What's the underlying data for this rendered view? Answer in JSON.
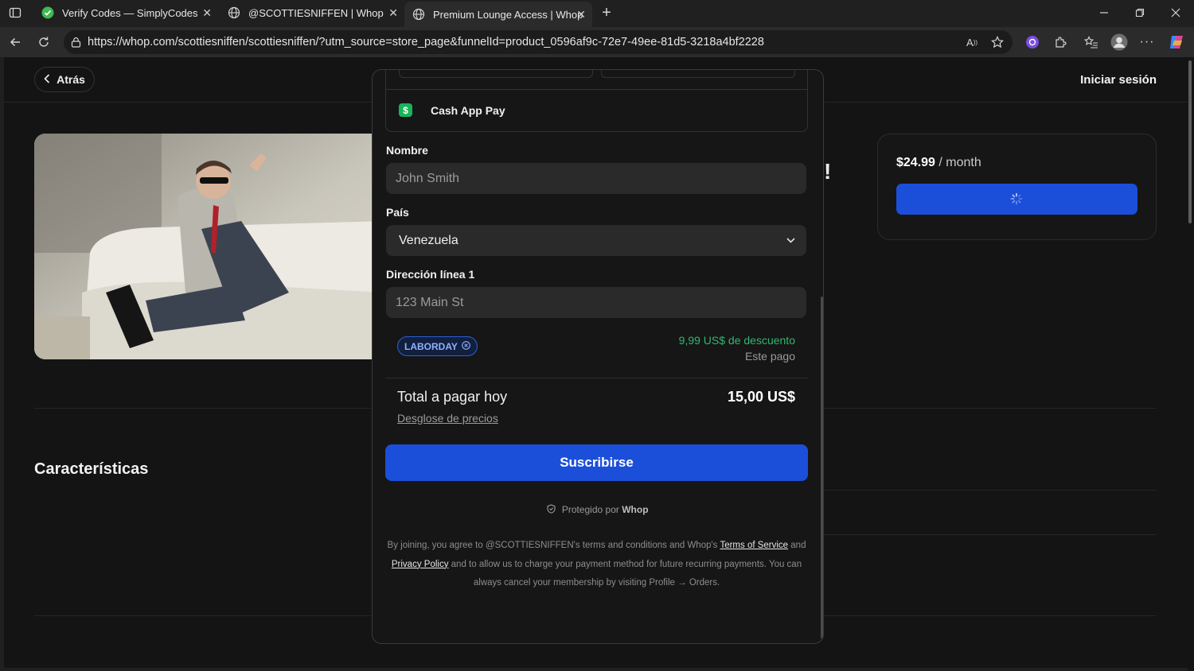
{
  "browser": {
    "tabs": [
      {
        "title": "Verify Codes — SimplyCodes",
        "icon": "simplycodes-check-icon",
        "active": false
      },
      {
        "title": "@SCOTTIESNIFFEN | Whop",
        "icon": "globe-icon",
        "active": false
      },
      {
        "title": "Premium Lounge Access | Whop",
        "icon": "globe-icon",
        "active": true
      }
    ],
    "url": "https://whop.com/scottiesniffen/scottiesniffen/?utm_source=store_page&funnelId=product_0596af9c-72e7-49ee-81d5-3218a4bf2228"
  },
  "header": {
    "back_label": "Atrás",
    "login_label": "Iniciar sesión"
  },
  "pricing_card": {
    "price": "$24.99",
    "period": " / month"
  },
  "sections": {
    "features_title": "Características",
    "bang": "!"
  },
  "checkout": {
    "payment_method": {
      "label": "Cash App Pay",
      "icon_glyph": "$"
    },
    "name_label": "Nombre",
    "name_placeholder": "John Smith",
    "country_label": "País",
    "country_value": "Venezuela",
    "address_label": "Dirección línea 1",
    "address_placeholder": "123 Main St",
    "coupon_code": "LABORDAY",
    "discount_text": "9,99 US$ de descuento",
    "discount_sub": "Este pago",
    "total_label": "Total a pagar hoy",
    "total_value": "15,00 US$",
    "breakdown_link": "Desglose de precios",
    "subscribe_label": "Suscribirse",
    "protected_prefix": "Protegido por ",
    "protected_brand": "Whop",
    "legal_1": "By joining, you agree to @SCOTTIESNIFFEN's terms and conditions and Whop's ",
    "legal_tos": "Terms of Service",
    "legal_2": " and ",
    "legal_privacy": "Privacy Policy",
    "legal_3": " and to allow us to charge your payment method for future recurring payments. You can always cancel your membership by visiting Profile → Orders."
  },
  "colors": {
    "accent_blue": "#1c4fd9",
    "discount_green": "#35b571",
    "cashapp_green": "#19b35a"
  }
}
